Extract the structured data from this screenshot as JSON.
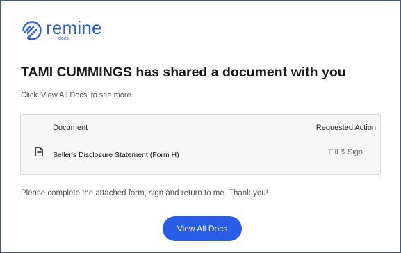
{
  "brand": {
    "name": "remine",
    "sub": "docs",
    "color": "#2a5ee8"
  },
  "message": {
    "headline": "TAMI CUMMINGS has shared a document with you",
    "subline": "Click 'View All Docs' to see more.",
    "closing": "Please complete the attached form, sign and return to me. Thank you!"
  },
  "documents": {
    "columns": {
      "document": "Document",
      "action": "Requested Action"
    },
    "rows": [
      {
        "icon": "document-icon",
        "name": "Seller's Disclosure Statement (Form H)",
        "action": "Fill & Sign"
      }
    ]
  },
  "cta": {
    "label": "View All Docs",
    "color": "#2a5ee8"
  }
}
